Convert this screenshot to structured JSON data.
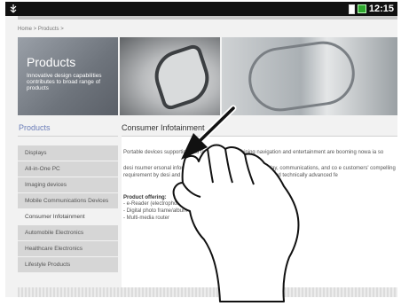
{
  "status_bar": {
    "time": "12:15",
    "icons": [
      "usb-icon",
      "battery-icon",
      "signal-icon"
    ]
  },
  "breadcrumb": "Home > Products >",
  "banner": {
    "title": "Products",
    "subtitle": "Innovative design capabilities contributes to broad range of products"
  },
  "sidebar": {
    "heading": "Products",
    "items": [
      {
        "label": "Displays"
      },
      {
        "label": "All-in-One PC"
      },
      {
        "label": "Imaging devices"
      },
      {
        "label": "Mobile Communications Devices"
      },
      {
        "label": "Consumer Infotainment"
      },
      {
        "label": "Automobile Electronics"
      },
      {
        "label": "Healthcare Electronics"
      },
      {
        "label": "Lifestyle Products"
      }
    ]
  },
  "main": {
    "title": "Consumer Infotainment",
    "para1": "Portable devices supporting info  timedia, and combining navigation and entertainment are booming nowa  ia so",
    "para2": "desi  nsumer  ersonal infor  by leveraging our capabilities of display, communications, and co  e customers' compelling requirement by desi and manufacturing products  r friendliness, and technically advanced fe",
    "offer_title": "Product offering:",
    "offers": [
      "- e-Reader (electrophoretic display",
      "- Digital photo frame/album",
      "- Multi-media router"
    ]
  },
  "colors": {
    "heading_accent": "#6b7db8",
    "status_bar": "#111111",
    "sidebar_item": "#d6d6d6"
  }
}
